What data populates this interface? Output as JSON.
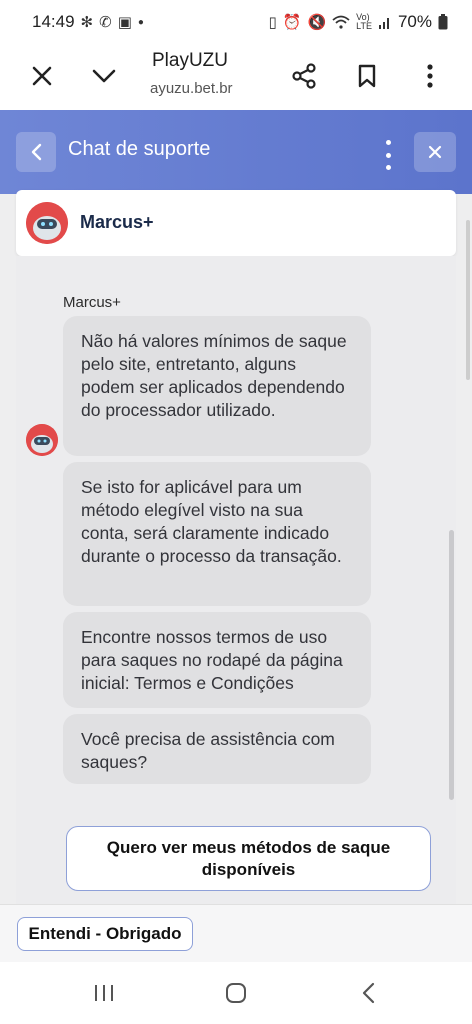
{
  "status_bar": {
    "time": "14:49",
    "battery": "70%",
    "left_icons": [
      "pinwheel-icon",
      "whatsapp-icon",
      "image-icon",
      "dot-icon"
    ],
    "right_icons": [
      "battery-saver-icon",
      "alarm-icon",
      "mute-icon",
      "wifi-icon",
      "volte-icon",
      "signal-icon",
      "battery-icon"
    ]
  },
  "browser": {
    "title": "PlayUZU",
    "url": "ayuzu.bet.br"
  },
  "chat": {
    "header_title": "Chat de suporte",
    "agent_name": "Marcus+",
    "sender_label": "Marcus+",
    "messages": [
      "Não há valores mínimos de saque pelo site, entretanto, alguns podem ser aplicados dependendo do processador utilizado.",
      "Se isto for aplicável para um método elegível visto na sua conta, será claramente indicado durante o processo da transação.",
      "Encontre nossos termos de uso para saques no rodapé da página inicial: Termos e Condições",
      "Você precisa de assistência com saques?"
    ],
    "quick_reply": "Quero ver meus métodos de saque disponíveis",
    "bottom_button": "Entendi - Obrigado"
  },
  "colors": {
    "header_gradient_start": "#6f86d6",
    "header_gradient_end": "#5c74cc",
    "bubble": "#e0e0e2",
    "button_border": "#8ea0d8",
    "avatar": "#e24a4a"
  }
}
